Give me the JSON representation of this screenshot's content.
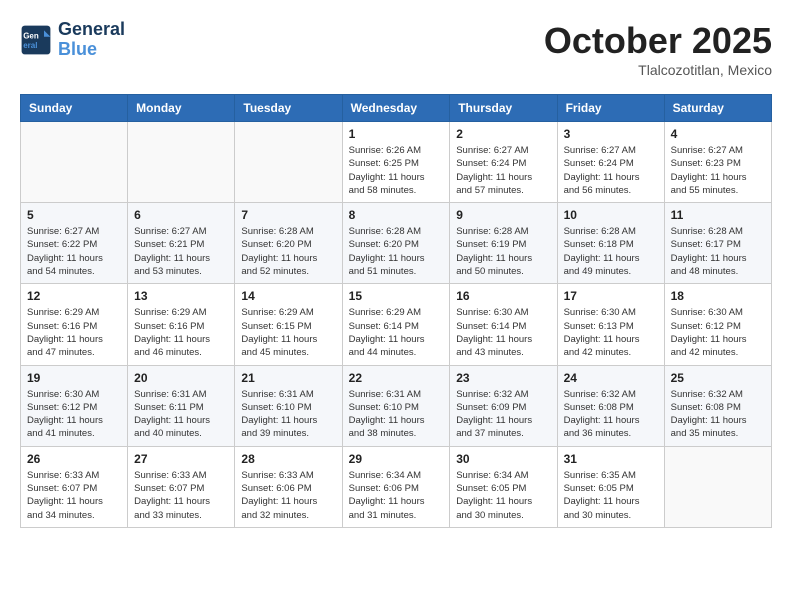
{
  "header": {
    "logo_text_general": "General",
    "logo_text_blue": "Blue",
    "month": "October 2025",
    "location": "Tlalcozotitlan, Mexico"
  },
  "days_of_week": [
    "Sunday",
    "Monday",
    "Tuesday",
    "Wednesday",
    "Thursday",
    "Friday",
    "Saturday"
  ],
  "weeks": [
    [
      {
        "day": "",
        "info": ""
      },
      {
        "day": "",
        "info": ""
      },
      {
        "day": "",
        "info": ""
      },
      {
        "day": "1",
        "info": "Sunrise: 6:26 AM\nSunset: 6:25 PM\nDaylight: 11 hours\nand 58 minutes."
      },
      {
        "day": "2",
        "info": "Sunrise: 6:27 AM\nSunset: 6:24 PM\nDaylight: 11 hours\nand 57 minutes."
      },
      {
        "day": "3",
        "info": "Sunrise: 6:27 AM\nSunset: 6:24 PM\nDaylight: 11 hours\nand 56 minutes."
      },
      {
        "day": "4",
        "info": "Sunrise: 6:27 AM\nSunset: 6:23 PM\nDaylight: 11 hours\nand 55 minutes."
      }
    ],
    [
      {
        "day": "5",
        "info": "Sunrise: 6:27 AM\nSunset: 6:22 PM\nDaylight: 11 hours\nand 54 minutes."
      },
      {
        "day": "6",
        "info": "Sunrise: 6:27 AM\nSunset: 6:21 PM\nDaylight: 11 hours\nand 53 minutes."
      },
      {
        "day": "7",
        "info": "Sunrise: 6:28 AM\nSunset: 6:20 PM\nDaylight: 11 hours\nand 52 minutes."
      },
      {
        "day": "8",
        "info": "Sunrise: 6:28 AM\nSunset: 6:20 PM\nDaylight: 11 hours\nand 51 minutes."
      },
      {
        "day": "9",
        "info": "Sunrise: 6:28 AM\nSunset: 6:19 PM\nDaylight: 11 hours\nand 50 minutes."
      },
      {
        "day": "10",
        "info": "Sunrise: 6:28 AM\nSunset: 6:18 PM\nDaylight: 11 hours\nand 49 minutes."
      },
      {
        "day": "11",
        "info": "Sunrise: 6:28 AM\nSunset: 6:17 PM\nDaylight: 11 hours\nand 48 minutes."
      }
    ],
    [
      {
        "day": "12",
        "info": "Sunrise: 6:29 AM\nSunset: 6:16 PM\nDaylight: 11 hours\nand 47 minutes."
      },
      {
        "day": "13",
        "info": "Sunrise: 6:29 AM\nSunset: 6:16 PM\nDaylight: 11 hours\nand 46 minutes."
      },
      {
        "day": "14",
        "info": "Sunrise: 6:29 AM\nSunset: 6:15 PM\nDaylight: 11 hours\nand 45 minutes."
      },
      {
        "day": "15",
        "info": "Sunrise: 6:29 AM\nSunset: 6:14 PM\nDaylight: 11 hours\nand 44 minutes."
      },
      {
        "day": "16",
        "info": "Sunrise: 6:30 AM\nSunset: 6:14 PM\nDaylight: 11 hours\nand 43 minutes."
      },
      {
        "day": "17",
        "info": "Sunrise: 6:30 AM\nSunset: 6:13 PM\nDaylight: 11 hours\nand 42 minutes."
      },
      {
        "day": "18",
        "info": "Sunrise: 6:30 AM\nSunset: 6:12 PM\nDaylight: 11 hours\nand 42 minutes."
      }
    ],
    [
      {
        "day": "19",
        "info": "Sunrise: 6:30 AM\nSunset: 6:12 PM\nDaylight: 11 hours\nand 41 minutes."
      },
      {
        "day": "20",
        "info": "Sunrise: 6:31 AM\nSunset: 6:11 PM\nDaylight: 11 hours\nand 40 minutes."
      },
      {
        "day": "21",
        "info": "Sunrise: 6:31 AM\nSunset: 6:10 PM\nDaylight: 11 hours\nand 39 minutes."
      },
      {
        "day": "22",
        "info": "Sunrise: 6:31 AM\nSunset: 6:10 PM\nDaylight: 11 hours\nand 38 minutes."
      },
      {
        "day": "23",
        "info": "Sunrise: 6:32 AM\nSunset: 6:09 PM\nDaylight: 11 hours\nand 37 minutes."
      },
      {
        "day": "24",
        "info": "Sunrise: 6:32 AM\nSunset: 6:08 PM\nDaylight: 11 hours\nand 36 minutes."
      },
      {
        "day": "25",
        "info": "Sunrise: 6:32 AM\nSunset: 6:08 PM\nDaylight: 11 hours\nand 35 minutes."
      }
    ],
    [
      {
        "day": "26",
        "info": "Sunrise: 6:33 AM\nSunset: 6:07 PM\nDaylight: 11 hours\nand 34 minutes."
      },
      {
        "day": "27",
        "info": "Sunrise: 6:33 AM\nSunset: 6:07 PM\nDaylight: 11 hours\nand 33 minutes."
      },
      {
        "day": "28",
        "info": "Sunrise: 6:33 AM\nSunset: 6:06 PM\nDaylight: 11 hours\nand 32 minutes."
      },
      {
        "day": "29",
        "info": "Sunrise: 6:34 AM\nSunset: 6:06 PM\nDaylight: 11 hours\nand 31 minutes."
      },
      {
        "day": "30",
        "info": "Sunrise: 6:34 AM\nSunset: 6:05 PM\nDaylight: 11 hours\nand 30 minutes."
      },
      {
        "day": "31",
        "info": "Sunrise: 6:35 AM\nSunset: 6:05 PM\nDaylight: 11 hours\nand 30 minutes."
      },
      {
        "day": "",
        "info": ""
      }
    ]
  ]
}
